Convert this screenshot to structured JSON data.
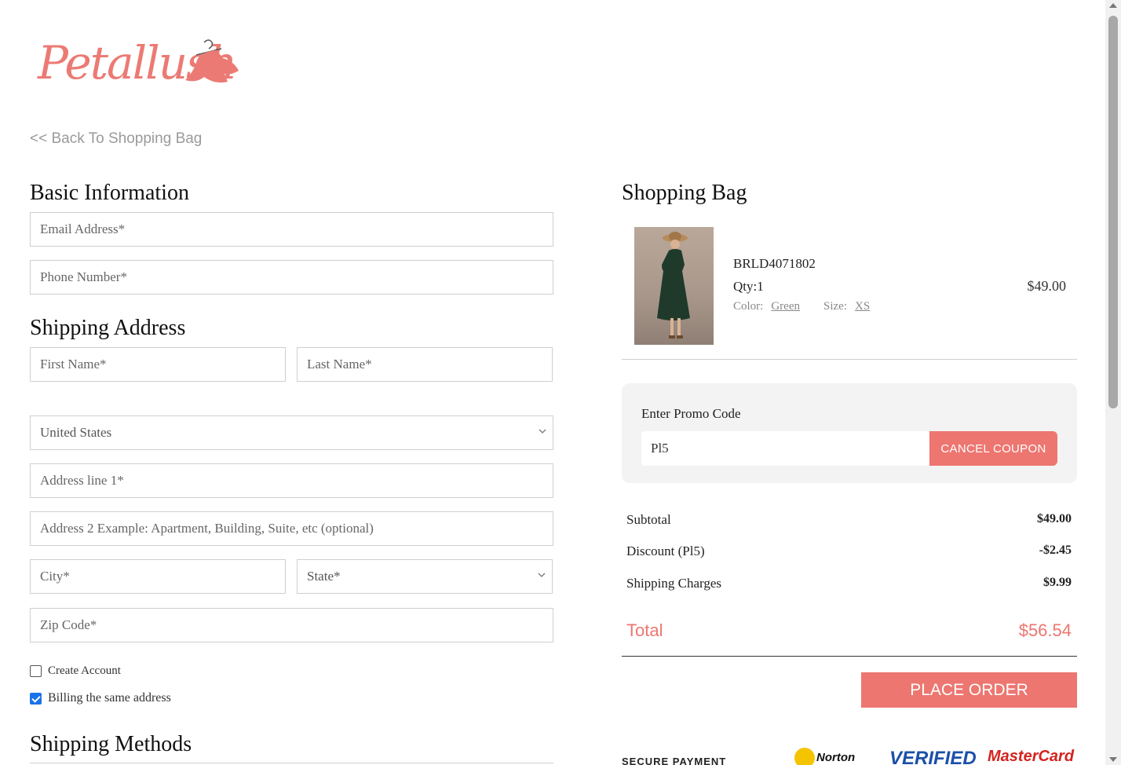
{
  "brand": {
    "name": "Petallush",
    "color": "#ec7a74"
  },
  "nav": {
    "back_label": "<< Back To Shopping Bag"
  },
  "basic_info": {
    "title": "Basic Information",
    "email_placeholder": "Email Address*",
    "phone_placeholder": "Phone Number*"
  },
  "shipping": {
    "title": "Shipping Address",
    "first_name_placeholder": "First Name*",
    "last_name_placeholder": "Last Name*",
    "country_selected": "United States",
    "address1_placeholder": "Address line 1*",
    "address2_placeholder": "Address 2 Example: Apartment, Building, Suite, etc (optional)",
    "city_placeholder": "City*",
    "state_selected": "State*",
    "zip_placeholder": "Zip Code*"
  },
  "options": {
    "create_account_label": "Create Account",
    "create_account_checked": false,
    "billing_same_label": "Billing the same address",
    "billing_same_checked": true
  },
  "shipping_methods": {
    "title": "Shipping Methods"
  },
  "bag": {
    "title": "Shopping Bag",
    "item": {
      "sku": "BRLD4071802",
      "qty_label": "Qty:1",
      "color_label": "Color:",
      "color_value": "Green",
      "size_label": "Size:",
      "size_value": "XS",
      "price": "$49.00",
      "image": "product-photo-green-dress"
    }
  },
  "promo": {
    "label": "Enter Promo Code",
    "code_value": "Pl5",
    "cancel_label": "CANCEL COUPON"
  },
  "summary": {
    "subtotal_label": "Subtotal",
    "subtotal_value": "$49.00",
    "discount_label": "Discount (Pl5)",
    "discount_value": "-$2.45",
    "shipping_label": "Shipping Charges",
    "shipping_value": "$9.99",
    "total_label": "Total",
    "total_value": "$56.54"
  },
  "checkout": {
    "place_order_label": "PLACE ORDER"
  },
  "trust": {
    "secure_text": "SECURE PAYMENT",
    "norton": "Norton",
    "verified": "VERIFIED",
    "mastercard": "MasterCard"
  },
  "colors": {
    "accent": "#ed7670",
    "border": "#cfcfcf",
    "promo_bg": "#f3f3f3"
  }
}
